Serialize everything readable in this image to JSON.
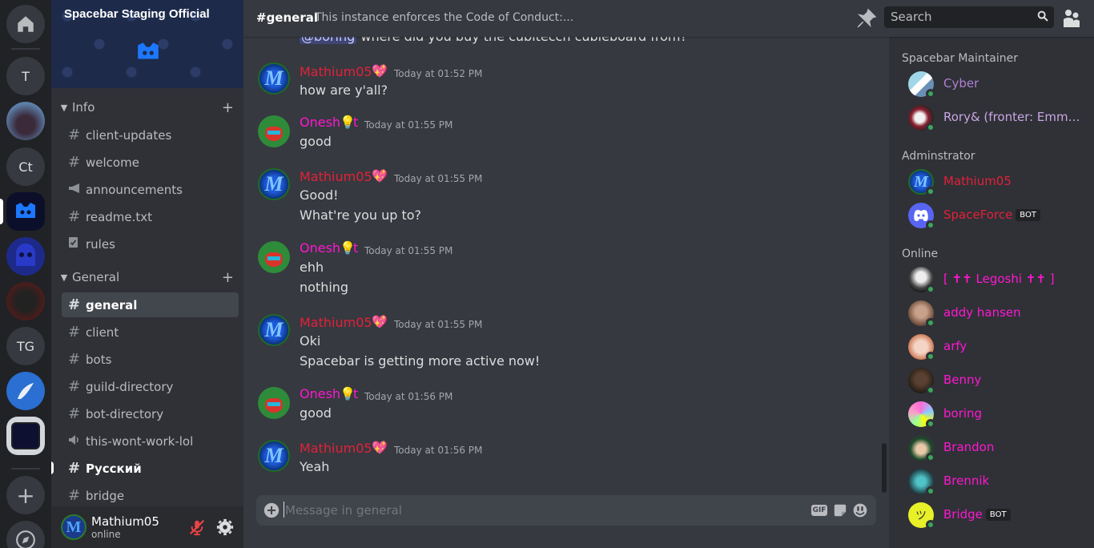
{
  "guilds": {
    "home_label": "Home",
    "items": [
      "T",
      "Ct",
      "TG"
    ],
    "add_label": "+",
    "explore_label": "Explore"
  },
  "server": {
    "name": "Spacebar Staging Official"
  },
  "categories": [
    {
      "name": "Info",
      "channels": [
        {
          "name": "client-updates",
          "icon": "hash-icon"
        },
        {
          "name": "welcome",
          "icon": "hash-icon"
        },
        {
          "name": "announcements",
          "icon": "megaphone-icon"
        },
        {
          "name": "readme.txt",
          "icon": "hash-icon"
        },
        {
          "name": "rules",
          "icon": "rules-icon"
        }
      ]
    },
    {
      "name": "General",
      "channels": [
        {
          "name": "general",
          "icon": "hash-icon",
          "selected": true
        },
        {
          "name": "client",
          "icon": "hash-icon"
        },
        {
          "name": "bots",
          "icon": "hash-icon"
        },
        {
          "name": "guild-directory",
          "icon": "hash-icon"
        },
        {
          "name": "bot-directory",
          "icon": "hash-icon"
        },
        {
          "name": "this-wont-work-lol",
          "icon": "speaker-icon"
        },
        {
          "name": "Русский",
          "icon": "hash-icon",
          "unread": true
        },
        {
          "name": "bridge",
          "icon": "hash-icon"
        }
      ]
    }
  ],
  "user": {
    "name": "Mathium05",
    "status": "online",
    "avatar_letter": "M"
  },
  "header": {
    "channel": "#general",
    "topic": "This instance enforces the Code of Conduct:...",
    "search_placeholder": "Search"
  },
  "messages": [
    {
      "partial": true,
      "lines": [
        "@boring where did you buy the cubiteccn cubieboard from?"
      ]
    },
    {
      "author": "Mathium05",
      "kind": "m",
      "badge": "💖",
      "time": "Today at 01:52 PM",
      "lines": [
        "how are y'all?"
      ]
    },
    {
      "author": "Onesh",
      "suffix": "t",
      "kind": "o",
      "time": "Today at 01:55 PM",
      "lines": [
        "good"
      ]
    },
    {
      "author": "Mathium05",
      "kind": "m",
      "badge": "💖",
      "time": "Today at 01:55 PM",
      "lines": [
        "Good!",
        "What're you up to?"
      ]
    },
    {
      "author": "Onesh",
      "suffix": "t",
      "kind": "o",
      "time": "Today at 01:55 PM",
      "lines": [
        "ehh",
        "nothing"
      ]
    },
    {
      "author": "Mathium05",
      "kind": "m",
      "badge": "💖",
      "time": "Today at 01:55 PM",
      "lines": [
        "Oki",
        "Spacebar is getting more active now!"
      ]
    },
    {
      "author": "Onesh",
      "suffix": "t",
      "kind": "o",
      "time": "Today at 01:56 PM",
      "lines": [
        "good"
      ]
    },
    {
      "author": "Mathium05",
      "kind": "m",
      "badge": "💖",
      "time": "Today at 01:56 PM",
      "lines": [
        "Yeah"
      ]
    }
  ],
  "composer": {
    "placeholder": "Message in general",
    "gif_label": "GIF"
  },
  "member_groups": [
    {
      "role": "Spacebar Maintainer",
      "members": [
        {
          "name": "Cyber",
          "color": "#b07fd4"
        },
        {
          "name": "Rory& (fronter: Emma [it...",
          "color": "#c9a6e4"
        }
      ]
    },
    {
      "role": "Adminstrator",
      "members": [
        {
          "name": "Mathium05",
          "color": "#e3203a"
        },
        {
          "name": "SpaceForce",
          "color": "#e3203a",
          "bot": "BOT"
        }
      ]
    },
    {
      "role": "Online",
      "members": [
        {
          "name": "[ ✝✝ Legoshi ✝✝ ]",
          "color": "#ff17d1"
        },
        {
          "name": "addy hansen",
          "color": "#ff17d1"
        },
        {
          "name": "arfy",
          "color": "#ff17d1"
        },
        {
          "name": "Benny",
          "color": "#ff17d1"
        },
        {
          "name": "boring",
          "color": "#ff17d1"
        },
        {
          "name": "Brandon",
          "color": "#ff17d1"
        },
        {
          "name": "Brennik",
          "color": "#ff17d1"
        },
        {
          "name": "Bridge",
          "color": "#ff17d1",
          "bot": "BOT"
        }
      ]
    }
  ]
}
